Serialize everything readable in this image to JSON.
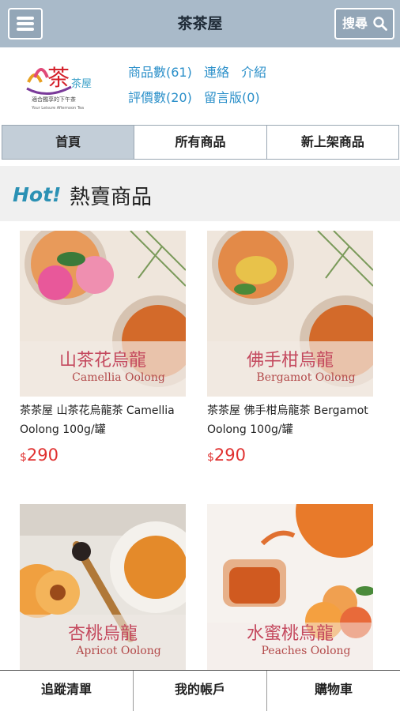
{
  "header": {
    "title": "茶茶屋",
    "search_label": "搜尋",
    "menu_icon": "hamburger-icon",
    "search_icon": "search-icon"
  },
  "shop": {
    "logo_text": "茶屋",
    "logo_tagline": "適合獨享的下午茶",
    "logo_tagline_en": "Your Leisure Afternoon Tea",
    "links": {
      "products": "商品數(61)",
      "contact": "連絡",
      "intro": "介紹",
      "reviews": "評價數(20)",
      "guestbook": "留言版(0)"
    }
  },
  "tabs": [
    {
      "label": "首頁",
      "active": true
    },
    {
      "label": "所有商品",
      "active": false
    },
    {
      "label": "新上架商品",
      "active": false
    }
  ],
  "section": {
    "badge": "Hot!",
    "title": "熱賣商品"
  },
  "products": [
    {
      "name": "茶茶屋 山茶花烏龍茶 Camellia Oolong 100g/罐",
      "currency": "$",
      "price": "290",
      "img_zh": "山茶花烏龍",
      "img_en": "Camellia Oolong"
    },
    {
      "name": "茶茶屋 佛手柑烏龍茶 Bergamot Oolong 100g/罐",
      "currency": "$",
      "price": "290",
      "img_zh": "佛手柑烏龍",
      "img_en": "Bergamot Oolong"
    },
    {
      "name": "",
      "currency": "",
      "price": "",
      "img_zh": "杏桃烏龍",
      "img_en": "Apricot Oolong"
    },
    {
      "name": "",
      "currency": "",
      "price": "",
      "img_zh": "水蜜桃烏龍",
      "img_en": "Peaches Oolong"
    }
  ],
  "bottom_nav": {
    "wishlist": "追蹤清單",
    "account": "我的帳戶",
    "cart": "購物車"
  }
}
